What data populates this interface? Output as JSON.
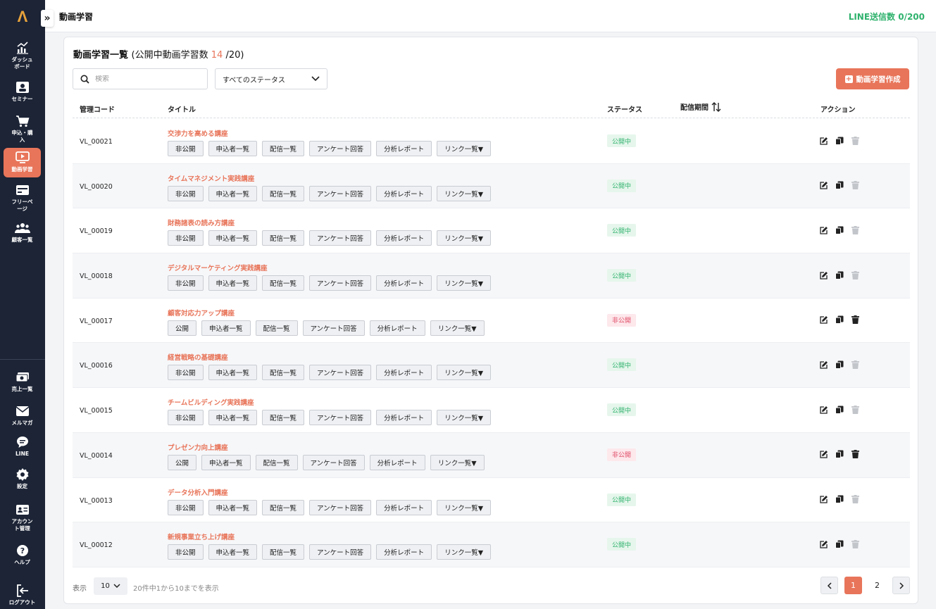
{
  "sidebar": {
    "logo": "Λ",
    "expand_icon": "»",
    "items": [
      {
        "label": "ダッシュ\nボード",
        "icon": "chart-icon"
      },
      {
        "label": "セミナー",
        "icon": "presenter-icon"
      },
      {
        "label": "申込・購\n入",
        "icon": "cart-icon"
      },
      {
        "label": "動画学習",
        "icon": "video-icon"
      },
      {
        "label": "フリーペ\nージ",
        "icon": "page-icon"
      },
      {
        "label": "顧客一覧",
        "icon": "users-icon"
      },
      {
        "label": "売上一覧",
        "icon": "money-icon"
      },
      {
        "label": "メルマガ",
        "icon": "mail-icon"
      },
      {
        "label": "LINE",
        "icon": "chat-icon"
      },
      {
        "label": "設定",
        "icon": "gear-icon"
      },
      {
        "label": "アカウン\nト管理",
        "icon": "id-card-icon"
      },
      {
        "label": "ヘルプ",
        "icon": "help-icon"
      },
      {
        "label": "ログアウト",
        "icon": "logout-icon"
      }
    ]
  },
  "topbar": {
    "title": "動画学習",
    "line_count": "LINE送信数 0/200"
  },
  "main": {
    "heading": "動画学習一覧",
    "heading_sub_prefix": "(公開中動画学習数 ",
    "heading_count": "14",
    "heading_sub_suffix": " /20)",
    "search_placeholder": "検索",
    "status_filter": "すべてのステータス",
    "create_button": "動画学習作成",
    "columns": {
      "code": "管理コード",
      "title": "タイトル",
      "status": "ステータス",
      "period": "配信期間",
      "actions": "アクション"
    },
    "row_buttons": [
      "申込者一覧",
      "配信一覧",
      "アンケート回答",
      "分析レポート",
      "リンク一覧▼"
    ],
    "rows": [
      {
        "code": "VL_00021",
        "title": "交渉力を高める講座",
        "toggle": "非公開",
        "status": "公開中"
      },
      {
        "code": "VL_00020",
        "title": "タイムマネジメント実践講座",
        "toggle": "非公開",
        "status": "公開中"
      },
      {
        "code": "VL_00019",
        "title": "財務諸表の読み方講座",
        "toggle": "非公開",
        "status": "公開中"
      },
      {
        "code": "VL_00018",
        "title": "デジタルマーケティング実践講座",
        "toggle": "非公開",
        "status": "公開中"
      },
      {
        "code": "VL_00017",
        "title": "顧客対応力アップ講座",
        "toggle": "公開",
        "status": "非公開"
      },
      {
        "code": "VL_00016",
        "title": "経営戦略の基礎講座",
        "toggle": "非公開",
        "status": "公開中"
      },
      {
        "code": "VL_00015",
        "title": "チームビルディング実践講座",
        "toggle": "非公開",
        "status": "公開中"
      },
      {
        "code": "VL_00014",
        "title": "プレゼン力向上講座",
        "toggle": "公開",
        "status": "非公開"
      },
      {
        "code": "VL_00013",
        "title": "データ分析入門講座",
        "toggle": "非公開",
        "status": "公開中"
      },
      {
        "code": "VL_00012",
        "title": "新規事業立ち上げ講座",
        "toggle": "非公開",
        "status": "公開中"
      }
    ],
    "footer": {
      "display_label": "表示",
      "per_page": "10",
      "info": "20件中1から10までを表示",
      "pages": [
        "1",
        "2"
      ],
      "current_page": "1"
    }
  },
  "colors": {
    "accent": "#e8755a",
    "sidebar_bg": "#1c2436",
    "public_green": "#2fb26d",
    "private_red": "#e04a64"
  }
}
